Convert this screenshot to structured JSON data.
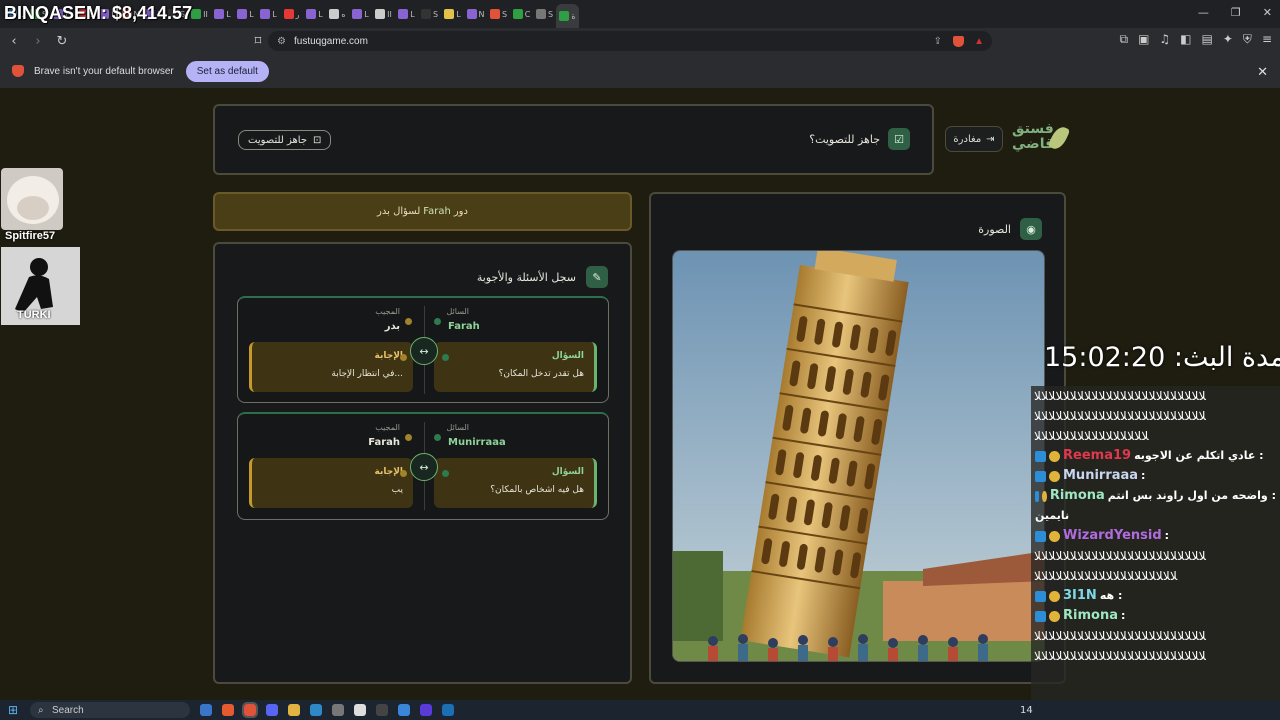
{
  "browser": {
    "tabs": [
      "L",
      "S",
      "L",
      "B",
      "L",
      "N",
      "L",
      "S",
      "II",
      "L",
      "L",
      "L",
      "ر",
      "L",
      "ه",
      "L",
      "II",
      "L",
      "S",
      "L",
      "N",
      "S",
      "C",
      "S",
      "ة"
    ],
    "tab_colors": [
      "#3d8bd9",
      "#2ea043",
      "#8a63d2",
      "#e53935",
      "#8a63d2",
      "#e0523a",
      "#8a63d2",
      "#333333",
      "#2ea043",
      "#8a63d2",
      "#8a63d2",
      "#8a63d2",
      "#e53935",
      "#8a63d2",
      "#cccccc",
      "#8a63d2",
      "#cccccc",
      "#8a63d2",
      "#333333",
      "#e3c24a",
      "#8a63d2",
      "#e0523a",
      "#2ea043",
      "#777777",
      "#2ea043"
    ],
    "url": "fustuqgame.com",
    "infobar_text": "Brave isn't your default browser",
    "set_default_label": "Set as default"
  },
  "overlay": {
    "streamer_label": "BINQASEM: $8,414.57",
    "cam1_name": "Spitfire57",
    "cam2_name": "TURKI",
    "timer": "مدة البث: 15:02:20"
  },
  "game": {
    "ready_button_label": "جاهز للتصويت",
    "ready_question": "جاهز للتصويت؟",
    "leave_label": "مغادرة",
    "logo_text_line1": "فستق",
    "logo_text_line2": "قاضي",
    "turn_prefix": "دور",
    "turn_name": "Farah",
    "turn_suffix": "لسؤال بدر",
    "log_title": "سجل الأسئلة والأجوبة",
    "image_title": "الصورة",
    "asker_label": "السائل",
    "answerer_label": "المجيب",
    "question_label": "السؤال",
    "answer_label": "الإجابة",
    "entries": [
      {
        "asker": "Farah",
        "answerer": "بدر",
        "question": "هل تقدر تدخل المكان؟",
        "answer": "في انتظار الإجابة..."
      },
      {
        "asker": "Munirraaa",
        "answerer": "Farah",
        "question": "هل فيه اشخاص بالمكان؟",
        "answer": "يب"
      }
    ]
  },
  "chat": {
    "messages": [
      {
        "type": "spam",
        "text": "ﻼﻼﻼﻼﻼﻼﻼﻼﻼﻼﻼﻼﻼﻼﻼﻼﻼﻼﻼﻼﻼﻼﻼﻼ"
      },
      {
        "type": "spam",
        "text": "ﻼﻼﻼﻼﻼﻼﻼﻼﻼﻼﻼﻼﻼﻼﻼﻼﻼﻼﻼﻼﻼﻼﻼﻼ"
      },
      {
        "type": "spam",
        "text": "ﻼﻼﻼﻼﻼﻼﻼﻼﻼﻼﻼﻼﻼﻼﻼﻼ"
      },
      {
        "type": "msg",
        "user": "Reema19",
        "color": "#e0384c",
        "text": "عادي اتكلم عن الاجوبه :"
      },
      {
        "type": "msg",
        "user": "Munirraaa",
        "color": "#c8d6f0",
        "text": ":"
      },
      {
        "type": "msg",
        "user": "Rimona",
        "color": "#9fe6c2",
        "text": "واضحه من اول راوند بس انتم :"
      },
      {
        "type": "plain",
        "text": "نايمين"
      },
      {
        "type": "msg",
        "user": "WizardYensid",
        "color": "#b16be0",
        "text": ":"
      },
      {
        "type": "spam",
        "text": "ﻼﻼﻼﻼﻼﻼﻼﻼﻼﻼﻼﻼﻼﻼﻼﻼﻼﻼﻼﻼﻼﻼﻼﻼ"
      },
      {
        "type": "spam",
        "text": "ﻼﻼﻼﻼﻼﻼﻼﻼﻼﻼﻼﻼﻼﻼﻼﻼﻼﻼﻼﻼ"
      },
      {
        "type": "msg",
        "user": "3I1N",
        "color": "#7fd8e8",
        "text": "هه :"
      },
      {
        "type": "msg",
        "user": "Rimona",
        "color": "#9fe6c2",
        "text": ":"
      },
      {
        "type": "spam",
        "text": "ﻼﻼﻼﻼﻼﻼﻼﻼﻼﻼﻼﻼﻼﻼﻼﻼﻼﻼﻼﻼﻼﻼﻼﻼ"
      },
      {
        "type": "spam",
        "text": "ﻼﻼﻼﻼﻼﻼﻼﻼﻼﻼﻼﻼﻼﻼﻼﻼﻼﻼﻼﻼﻼﻼﻼﻼ"
      }
    ]
  },
  "taskbar": {
    "search_placeholder": "Search",
    "tray_text": "14"
  }
}
